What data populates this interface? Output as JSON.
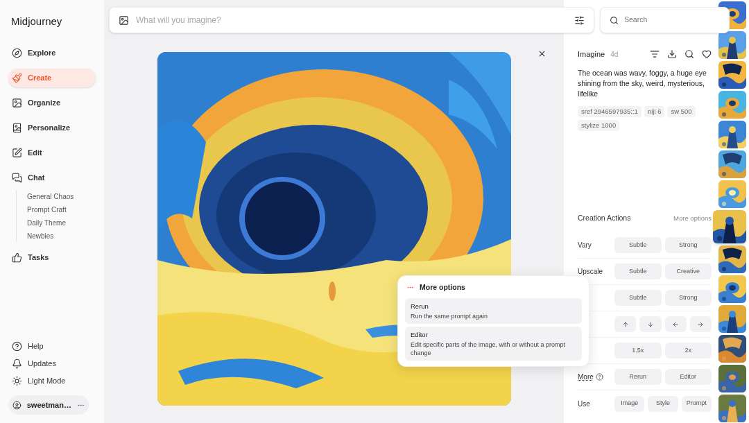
{
  "app": {
    "title": "Midjourney"
  },
  "nav": [
    {
      "label": "Explore",
      "selected": false
    },
    {
      "label": "Create",
      "selected": true
    },
    {
      "label": "Organize",
      "selected": false
    },
    {
      "label": "Personalize",
      "selected": false
    },
    {
      "label": "Edit",
      "selected": false
    },
    {
      "label": "Chat",
      "selected": false,
      "children": [
        {
          "label": "General Chaos"
        },
        {
          "label": "Prompt Craft"
        },
        {
          "label": "Daily Theme"
        },
        {
          "label": "Newbies"
        }
      ]
    },
    {
      "label": "Tasks",
      "selected": false
    }
  ],
  "footer_links": [
    {
      "label": "Help"
    },
    {
      "label": "Updates"
    },
    {
      "label": "Light Mode"
    }
  ],
  "user": {
    "name": "sweetman…"
  },
  "prompt_bar": {
    "placeholder": "What will you imagine?"
  },
  "search": {
    "placeholder": "Search"
  },
  "detail": {
    "title": "Imagine",
    "age": "4d",
    "prompt": "The ocean was wavy, foggy, a huge eye shining from the sky, weird, mysterious, lifelike",
    "params": [
      "sref 2946597935::1",
      "niji 6",
      "sw 500",
      "stylize 1000"
    ]
  },
  "actions": {
    "title": "Creation Actions",
    "more_link": "More options",
    "rows": [
      {
        "kind": "text",
        "label": "Vary",
        "buttons": [
          "Subtle",
          "Strong"
        ]
      },
      {
        "kind": "text",
        "label": "Upscale",
        "buttons": [
          "Subtle",
          "Creative"
        ]
      },
      {
        "kind": "text",
        "buttons": [
          "Subtle",
          "Strong"
        ]
      },
      {
        "kind": "arrows"
      },
      {
        "kind": "text",
        "buttons": [
          "1.5x",
          "2x"
        ]
      },
      {
        "kind": "text",
        "label": "More",
        "help": true,
        "buttons": [
          "Rerun",
          "Editor"
        ]
      },
      {
        "kind": "text",
        "label": "Use",
        "buttons": [
          "Image",
          "Style",
          "Prompt"
        ]
      }
    ]
  },
  "popup": {
    "title": "More options",
    "items": [
      {
        "title": "Rerun",
        "description": "Run the same prompt again"
      },
      {
        "title": "Editor",
        "description": "Edit specific parts of the image, with or without a prompt change"
      }
    ]
  },
  "thumbnails": [
    {
      "kind": "picture",
      "selected": false
    },
    {
      "kind": "picture",
      "selected": false
    },
    {
      "kind": "picture",
      "selected": false
    },
    {
      "kind": "picture",
      "selected": false
    },
    {
      "kind": "picture",
      "selected": false
    },
    {
      "kind": "picture",
      "selected": false
    },
    {
      "kind": "picture",
      "selected": false
    },
    {
      "kind": "picture",
      "selected": true
    },
    {
      "kind": "picture",
      "selected": false
    },
    {
      "kind": "picture",
      "selected": false
    },
    {
      "kind": "picture",
      "selected": false
    },
    {
      "kind": "picture",
      "selected": false
    },
    {
      "kind": "picture",
      "selected": false
    },
    {
      "kind": "picture",
      "selected": false
    }
  ]
}
